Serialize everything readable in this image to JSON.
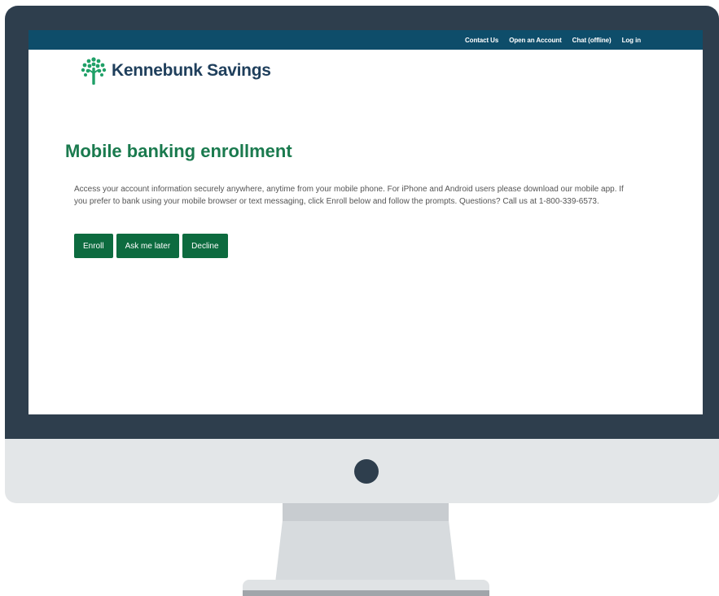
{
  "header": {
    "links": [
      {
        "label": "Contact Us"
      },
      {
        "label": "Open an Account"
      },
      {
        "label": "Chat (offline)"
      },
      {
        "label": "Log in"
      }
    ]
  },
  "brand": {
    "name": "Kennebunk Savings",
    "icon": "tree-icon",
    "color": "#1fa067"
  },
  "main": {
    "title": "Mobile banking enrollment",
    "description": "Access your account information securely anywhere, anytime from your mobile phone. For iPhone and Android users please download our mobile app. If you prefer to bank using your mobile browser or text messaging, click Enroll below and follow the prompts. Questions? Call us at 1-800-339-6573.",
    "buttons": {
      "enroll": "Enroll",
      "later": "Ask me later",
      "decline": "Decline"
    }
  },
  "colors": {
    "topbar": "#0e4d6a",
    "title": "#1a7a4e",
    "button": "#0d6b3f",
    "bezel": "#2e3e4d"
  }
}
